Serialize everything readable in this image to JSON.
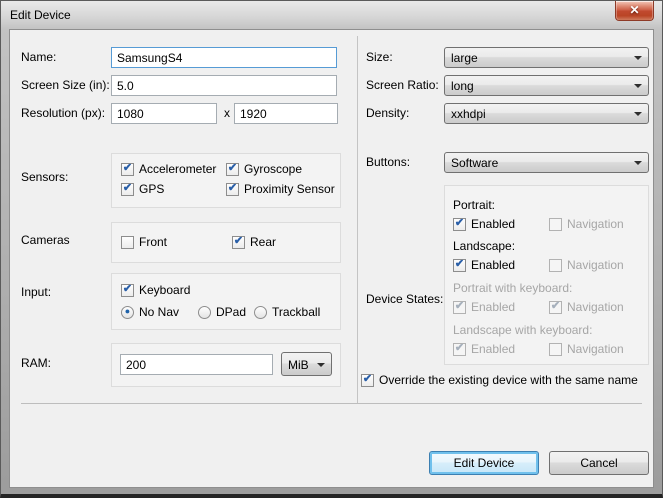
{
  "window": {
    "title": "Edit Device",
    "close_glyph": "✕"
  },
  "colors": {
    "focus_border": "#569bd5",
    "check_blue": "#2a5fa8",
    "disabled_text": "#a6a6a6",
    "close_red": "#c14a2f"
  },
  "left": {
    "name": {
      "label": "Name:",
      "value": "SamsungS4"
    },
    "screen_size": {
      "label": "Screen Size (in):",
      "value": "5.0"
    },
    "resolution": {
      "label": "Resolution (px):",
      "width_value": "1080",
      "separator": "x",
      "height_value": "1920"
    },
    "sensors": {
      "label": "Sensors:",
      "items": [
        {
          "label": "Accelerometer",
          "checked": true,
          "mark": "✔"
        },
        {
          "label": "Gyroscope",
          "checked": true,
          "mark": "✔"
        },
        {
          "label": "GPS",
          "checked": true,
          "mark": "✔"
        },
        {
          "label": "Proximity Sensor",
          "checked": true,
          "mark": "✔"
        }
      ]
    },
    "cameras": {
      "label": "Cameras",
      "items": [
        {
          "label": "Front",
          "checked": false,
          "mark": ""
        },
        {
          "label": "Rear",
          "checked": true,
          "mark": "✔"
        }
      ]
    },
    "input": {
      "label": "Input:",
      "keyboard": {
        "label": "Keyboard",
        "checked": true,
        "mark": "✔"
      },
      "nav": [
        {
          "label": "No Nav",
          "selected": true,
          "mark": "●"
        },
        {
          "label": "DPad",
          "selected": false,
          "mark": ""
        },
        {
          "label": "Trackball",
          "selected": false,
          "mark": ""
        }
      ]
    },
    "ram": {
      "label": "RAM:",
      "value": "200",
      "unit": "MiB"
    }
  },
  "right": {
    "size": {
      "label": "Size:",
      "value": "large"
    },
    "screen_ratio": {
      "label": "Screen Ratio:",
      "value": "long"
    },
    "density": {
      "label": "Density:",
      "value": "xxhdpi"
    },
    "buttons": {
      "label": "Buttons:",
      "value": "Software"
    },
    "device_states": {
      "label": "Device States:",
      "groups": [
        {
          "title": "Portrait:",
          "title_disabled": false,
          "enabled": {
            "label": "Enabled",
            "checked": true,
            "disabled": false,
            "mark": "✔"
          },
          "navigation": {
            "label": "Navigation",
            "checked": false,
            "disabled": true,
            "mark": ""
          }
        },
        {
          "title": "Landscape:",
          "title_disabled": false,
          "enabled": {
            "label": "Enabled",
            "checked": true,
            "disabled": false,
            "mark": "✔"
          },
          "navigation": {
            "label": "Navigation",
            "checked": false,
            "disabled": true,
            "mark": ""
          }
        },
        {
          "title": "Portrait with keyboard:",
          "title_disabled": true,
          "enabled": {
            "label": "Enabled",
            "checked": true,
            "disabled": true,
            "mark": "✔"
          },
          "navigation": {
            "label": "Navigation",
            "checked": true,
            "disabled": true,
            "mark": "✔"
          }
        },
        {
          "title": "Landscape with keyboard:",
          "title_disabled": true,
          "enabled": {
            "label": "Enabled",
            "checked": true,
            "disabled": true,
            "mark": "✔"
          },
          "navigation": {
            "label": "Navigation",
            "checked": false,
            "disabled": true,
            "mark": ""
          }
        }
      ]
    },
    "override": {
      "label": "Override the existing device with the same name",
      "checked": true,
      "mark": "✔"
    }
  },
  "footer": {
    "confirm_label": "Edit Device",
    "cancel_label": "Cancel"
  }
}
